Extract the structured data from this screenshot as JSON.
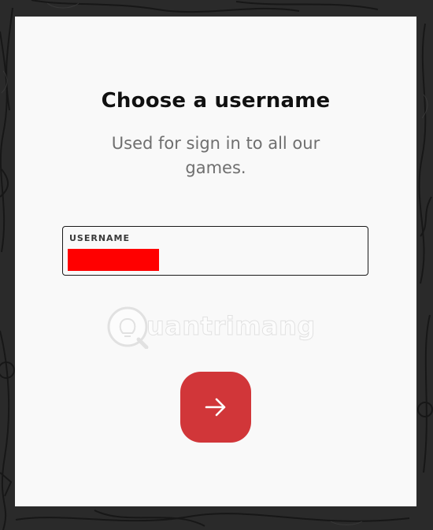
{
  "dialog": {
    "title": "Choose a username",
    "subtitle": "Used for sign in to all our games."
  },
  "username_field": {
    "label": "USERNAME",
    "value_redacted": true
  },
  "watermark": {
    "text": "uantrimang"
  },
  "next_button": {
    "icon": "arrow-right-icon"
  },
  "colors": {
    "accent": "#d13639",
    "redaction": "#ff0000",
    "card_background": "#f9f9f9",
    "page_background": "#262626"
  }
}
